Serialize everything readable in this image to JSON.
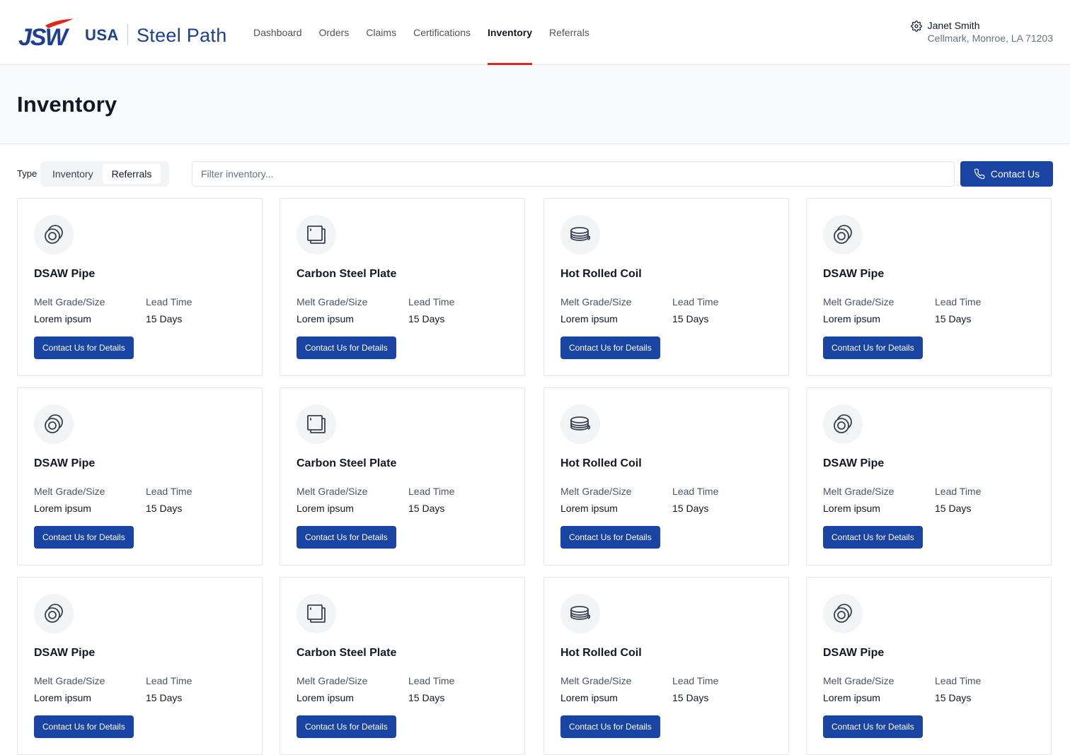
{
  "brand": {
    "logo_text": "JSW",
    "region": "USA",
    "product": "Steel Path",
    "accent_red": "#e1261c",
    "brand_blue": "#1d3f94"
  },
  "nav": [
    {
      "label": "Dashboard",
      "active": false
    },
    {
      "label": "Orders",
      "active": false
    },
    {
      "label": "Claims",
      "active": false
    },
    {
      "label": "Certifications",
      "active": false
    },
    {
      "label": "Inventory",
      "active": true
    },
    {
      "label": "Referrals",
      "active": false
    }
  ],
  "user": {
    "name": "Janet Smith",
    "address": "Cellmark, Monroe, LA 71203",
    "icon": "gear-icon"
  },
  "page": {
    "title": "Inventory"
  },
  "toolbar": {
    "type_label": "Type",
    "segments": [
      {
        "label": "Inventory",
        "selected": false
      },
      {
        "label": "Referrals",
        "selected": true
      }
    ],
    "filter_placeholder": "Filter inventory...",
    "filter_value": "",
    "contact_label": "Contact Us",
    "contact_icon": "phone-icon",
    "primary_color": "#1a44a3"
  },
  "cards": [
    {
      "title": "DSAW Pipe",
      "icon": "pipe-icon",
      "grade_label": "Melt Grade/Size",
      "grade_value": "Lorem ipsum",
      "lead_label": "Lead Time",
      "lead_value": "15 Days",
      "button": "Contact Us for Details"
    },
    {
      "title": "Carbon Steel Plate",
      "icon": "plate-icon",
      "grade_label": "Melt Grade/Size",
      "grade_value": "Lorem ipsum",
      "lead_label": "Lead Time",
      "lead_value": "15 Days",
      "button": "Contact Us for Details"
    },
    {
      "title": "Hot Rolled Coil",
      "icon": "coil-icon",
      "grade_label": "Melt Grade/Size",
      "grade_value": "Lorem ipsum",
      "lead_label": "Lead Time",
      "lead_value": "15 Days",
      "button": "Contact Us for Details"
    },
    {
      "title": "DSAW Pipe",
      "icon": "pipe-icon",
      "grade_label": "Melt Grade/Size",
      "grade_value": "Lorem ipsum",
      "lead_label": "Lead Time",
      "lead_value": "15 Days",
      "button": "Contact Us for Details"
    },
    {
      "title": "DSAW Pipe",
      "icon": "pipe-icon",
      "grade_label": "Melt Grade/Size",
      "grade_value": "Lorem ipsum",
      "lead_label": "Lead Time",
      "lead_value": "15 Days",
      "button": "Contact Us for Details"
    },
    {
      "title": "Carbon Steel Plate",
      "icon": "plate-icon",
      "grade_label": "Melt Grade/Size",
      "grade_value": "Lorem ipsum",
      "lead_label": "Lead Time",
      "lead_value": "15 Days",
      "button": "Contact Us for Details"
    },
    {
      "title": "Hot Rolled Coil",
      "icon": "coil-icon",
      "grade_label": "Melt Grade/Size",
      "grade_value": "Lorem ipsum",
      "lead_label": "Lead Time",
      "lead_value": "15 Days",
      "button": "Contact Us for Details"
    },
    {
      "title": "DSAW Pipe",
      "icon": "pipe-icon",
      "grade_label": "Melt Grade/Size",
      "grade_value": "Lorem ipsum",
      "lead_label": "Lead Time",
      "lead_value": "15 Days",
      "button": "Contact Us for Details"
    },
    {
      "title": "DSAW Pipe",
      "icon": "pipe-icon",
      "grade_label": "Melt Grade/Size",
      "grade_value": "Lorem ipsum",
      "lead_label": "Lead Time",
      "lead_value": "15 Days",
      "button": "Contact Us for Details"
    },
    {
      "title": "Carbon Steel Plate",
      "icon": "plate-icon",
      "grade_label": "Melt Grade/Size",
      "grade_value": "Lorem ipsum",
      "lead_label": "Lead Time",
      "lead_value": "15 Days",
      "button": "Contact Us for Details"
    },
    {
      "title": "Hot Rolled Coil",
      "icon": "coil-icon",
      "grade_label": "Melt Grade/Size",
      "grade_value": "Lorem ipsum",
      "lead_label": "Lead Time",
      "lead_value": "15 Days",
      "button": "Contact Us for Details"
    },
    {
      "title": "DSAW Pipe",
      "icon": "pipe-icon",
      "grade_label": "Melt Grade/Size",
      "grade_value": "Lorem ipsum",
      "lead_label": "Lead Time",
      "lead_value": "15 Days",
      "button": "Contact Us for Details"
    }
  ]
}
